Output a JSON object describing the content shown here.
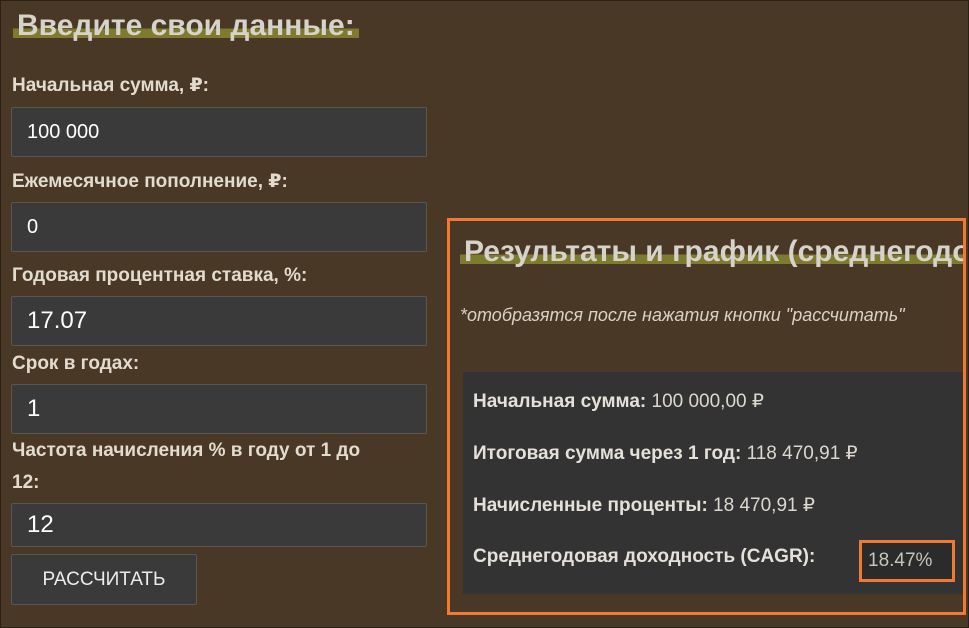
{
  "form": {
    "title": "Введите свои данные:",
    "fields": [
      {
        "label": "Начальная сумма, ₽:",
        "value": "100 000"
      },
      {
        "label": "Ежемесячное пополнение, ₽:",
        "value": "0"
      },
      {
        "label": "Годовая процентная ставка, %:",
        "value": "17.07"
      },
      {
        "label": "Срок в годах:",
        "value": "1"
      },
      {
        "label_line1": "Частота начисления % в году от 1 до",
        "label_line2": "12:",
        "value": "12"
      }
    ],
    "button_label": "РАССЧИТАТЬ"
  },
  "results": {
    "title": "Результаты и график (среднегодовой доходности)",
    "note": "*отобразятся после нажатия кнопки \"рассчитать\"",
    "rows": [
      {
        "label": "Начальная сумма:",
        "value": " 100 000,00 ₽"
      },
      {
        "label": "Итоговая сумма через 1 год:",
        "value": " 118 470,91 ₽"
      },
      {
        "label": "Начисленные проценты:",
        "value": " 18 470,91 ₽"
      },
      {
        "label": "Среднегодовая доходность (CAGR):",
        "value": "18.47%"
      }
    ]
  }
}
